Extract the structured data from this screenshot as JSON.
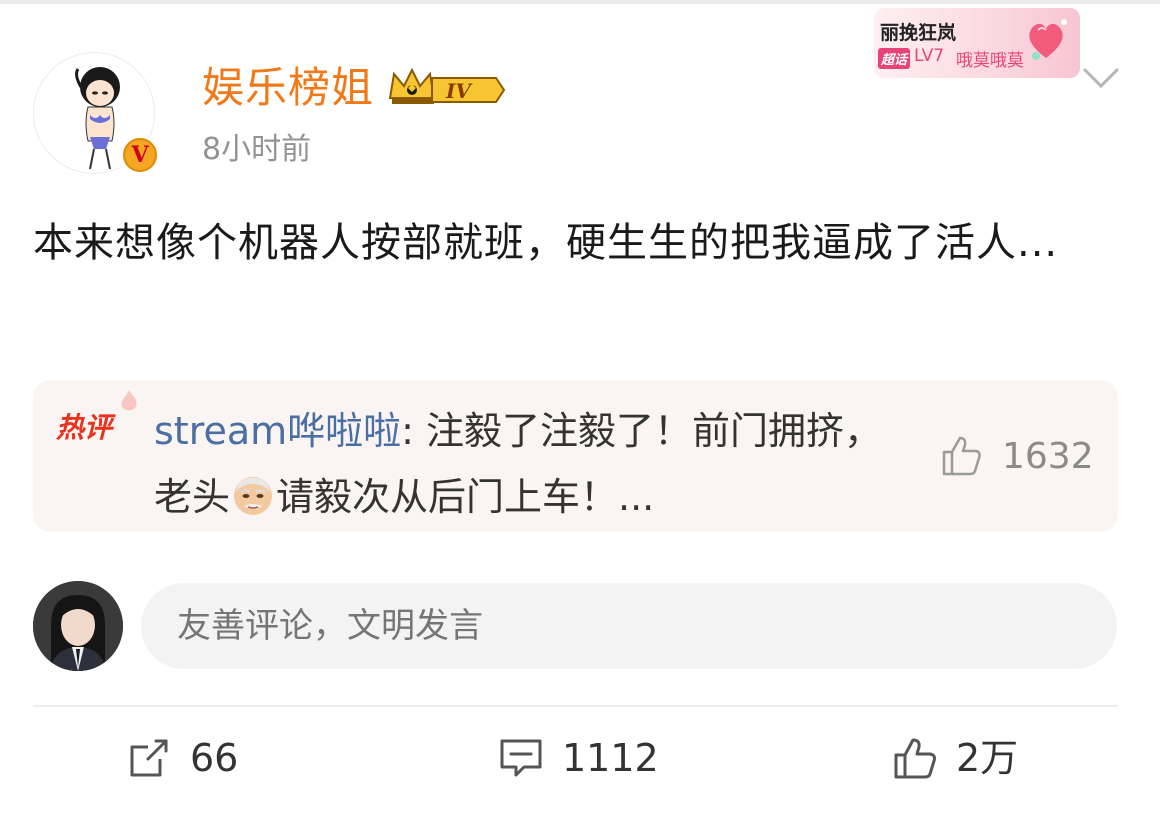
{
  "post": {
    "username": "娱乐榜姐",
    "level_badge": "IV",
    "timestamp": "8小时前",
    "content": "本来想像个机器人按部就班，硬生生的把我逼成了活人...",
    "fan_card": {
      "title": "丽挽狂岚",
      "tag": "超话",
      "level": "LV7",
      "name": "哦莫哦莫"
    }
  },
  "hot_comment": {
    "label": "热评",
    "user": "stream哗啦啦",
    "text_before_emoji": ": 注毅了注毅了！前门拥挤，老头",
    "text_after_emoji": "请毅次从后门上车！...",
    "like_count": "1632"
  },
  "comment_input": {
    "placeholder": "友善评论，文明发言"
  },
  "actions": {
    "share_count": "66",
    "comment_count": "1112",
    "like_count": "2万"
  },
  "colors": {
    "username": "#f07a1a",
    "hot_label": "#e8321e",
    "hot_user": "#4a6fa5",
    "hot_bg": "#faf4f2"
  },
  "icons": {
    "crown": "crown-icon",
    "verified": "verified-v-icon",
    "dropdown": "chevron-down-icon",
    "hot_like": "thumbs-up-icon",
    "share": "share-icon",
    "comment": "comment-icon",
    "like": "thumbs-up-icon"
  }
}
